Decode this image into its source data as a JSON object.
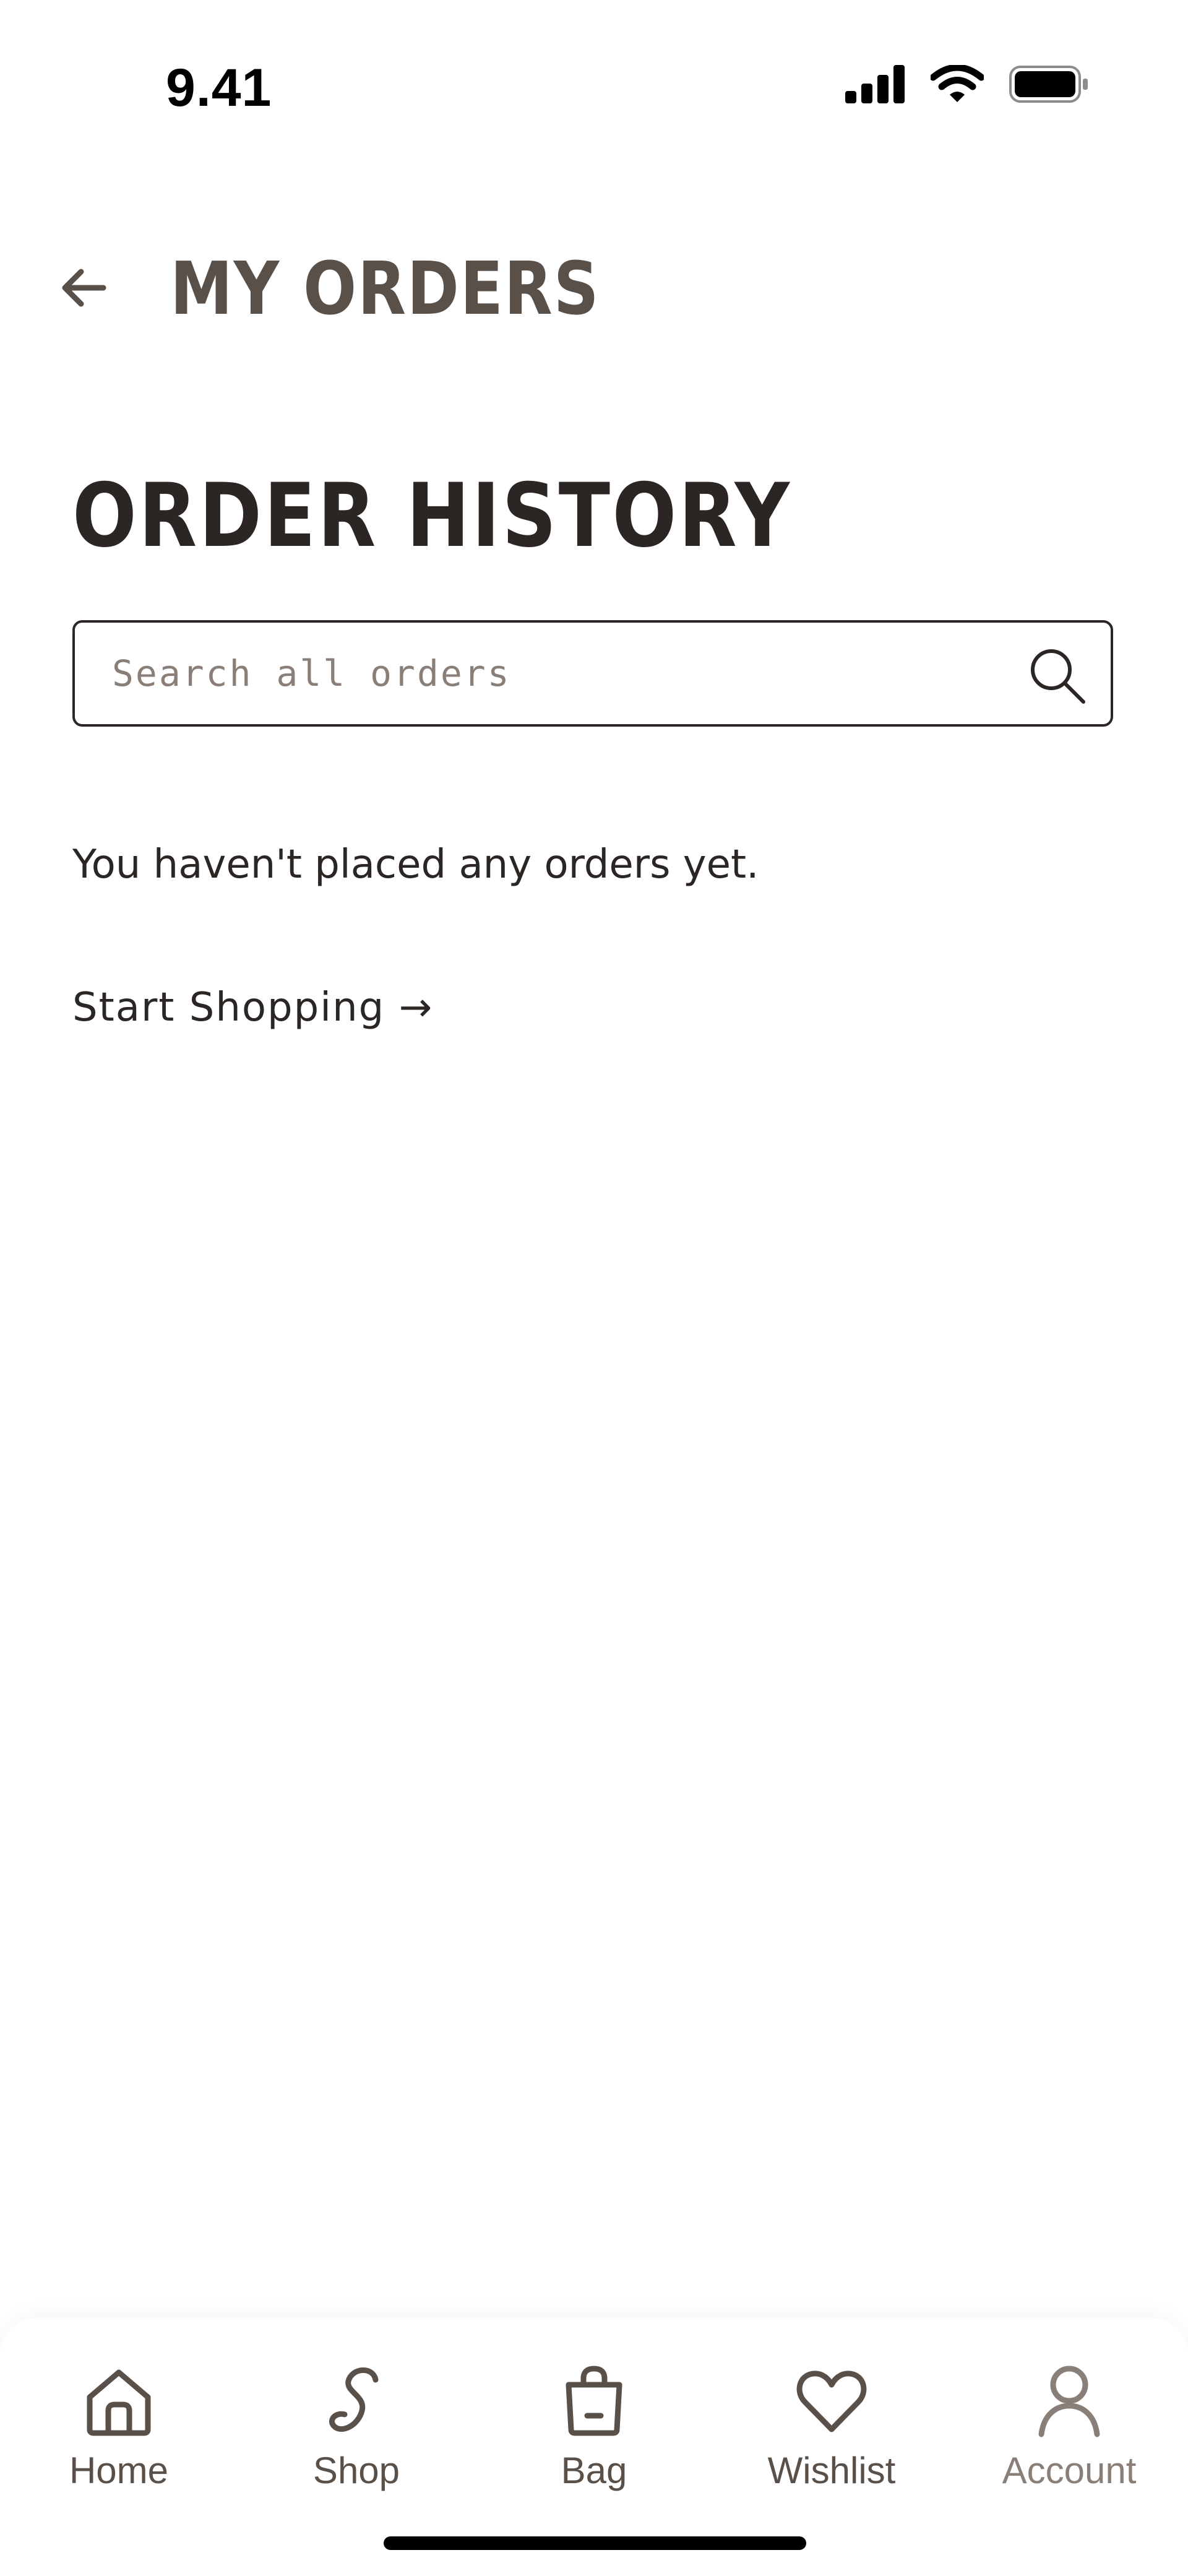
{
  "status_bar": {
    "time": "9.41",
    "icons": [
      "cellular-signal-icon",
      "wifi-icon",
      "battery-icon"
    ]
  },
  "header": {
    "back_icon": "arrow-left-icon",
    "title": "MY ORDERS"
  },
  "main": {
    "section_title": "ORDER HISTORY",
    "search": {
      "placeholder": "Search all orders",
      "value": "",
      "icon": "search-icon"
    },
    "empty_message": "You haven't placed any orders yet.",
    "start_shopping_label": "Start Shopping →"
  },
  "bottom_nav": {
    "items": [
      {
        "label": "Home",
        "icon": "home-icon",
        "active": false
      },
      {
        "label": "Shop",
        "icon": "shop-s-icon",
        "active": false
      },
      {
        "label": "Bag",
        "icon": "bag-icon",
        "active": false
      },
      {
        "label": "Wishlist",
        "icon": "heart-icon",
        "active": false
      },
      {
        "label": "Account",
        "icon": "user-icon",
        "active": true
      }
    ]
  },
  "colors": {
    "text_primary": "#2b2623",
    "text_muted": "#5a504a",
    "text_active": "#8a7f78",
    "background": "#ffffff"
  }
}
